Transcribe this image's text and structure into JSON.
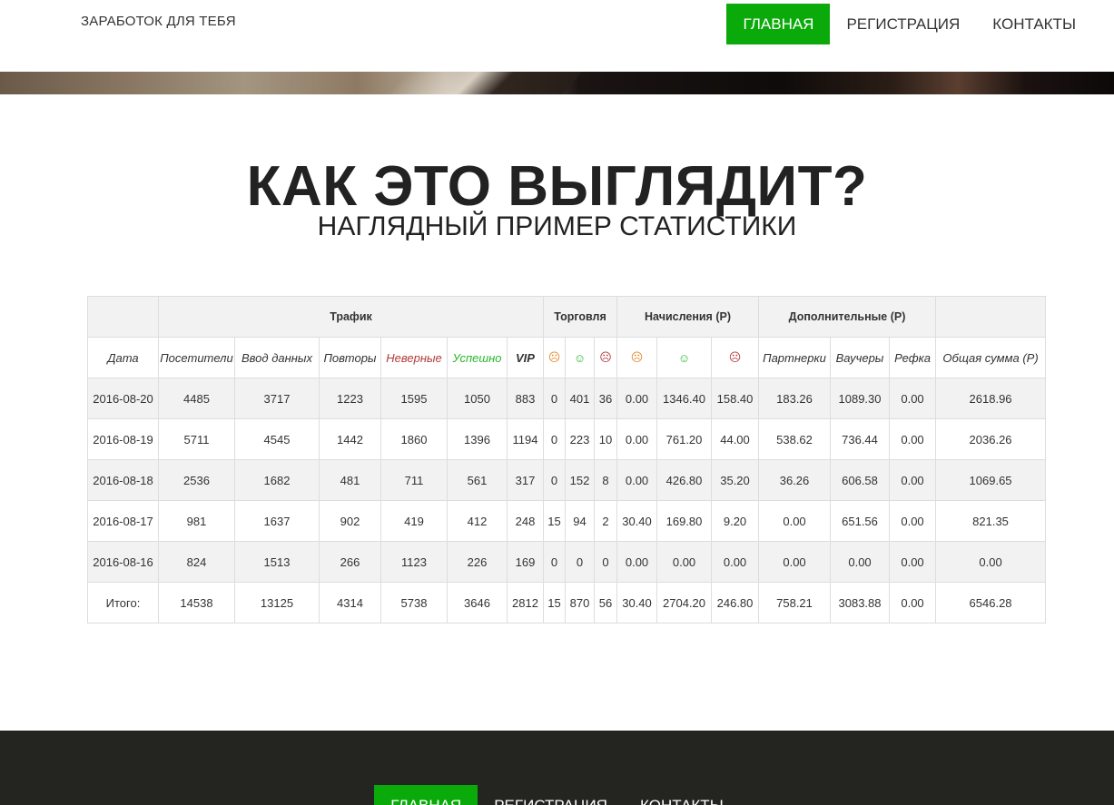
{
  "header": {
    "brand": "ЗАРАБОТОК ДЛЯ ТЕБЯ",
    "nav": [
      "ГЛАВНАЯ",
      "РЕГИСТРАЦИЯ",
      "КОНТАКТЫ"
    ]
  },
  "section": {
    "title": "КАК ЭТО ВЫГЛЯДИТ?",
    "subtitle": "НАГЛЯДНЫЙ ПРИМЕР СТАТИСТИКИ"
  },
  "table": {
    "groups": {
      "traffic": "Трафик",
      "trade": "Торговля",
      "accruals": "Начисления (Р)",
      "extra": "Дополнительные (Р)"
    },
    "columns": [
      "Дата",
      "Посетители",
      "Ввод данных",
      "Повторы",
      "Неверные",
      "Успешно",
      "VIP",
      "☹",
      "☺",
      "☹",
      "☹",
      "☺",
      "☹",
      "Партнерки",
      "Ваучеры",
      "Рефка",
      "Общая сумма (Р)"
    ],
    "rows": [
      [
        "2016-08-20",
        "4485",
        "3717",
        "1223",
        "1595",
        "1050",
        "883",
        "0",
        "401",
        "36",
        "0.00",
        "1346.40",
        "158.40",
        "183.26",
        "1089.30",
        "0.00",
        "2618.96"
      ],
      [
        "2016-08-19",
        "5711",
        "4545",
        "1442",
        "1860",
        "1396",
        "1194",
        "0",
        "223",
        "10",
        "0.00",
        "761.20",
        "44.00",
        "538.62",
        "736.44",
        "0.00",
        "2036.26"
      ],
      [
        "2016-08-18",
        "2536",
        "1682",
        "481",
        "711",
        "561",
        "317",
        "0",
        "152",
        "8",
        "0.00",
        "426.80",
        "35.20",
        "36.26",
        "606.58",
        "0.00",
        "1069.65"
      ],
      [
        "2016-08-17",
        "981",
        "1637",
        "902",
        "419",
        "412",
        "248",
        "15",
        "94",
        "2",
        "30.40",
        "169.80",
        "9.20",
        "0.00",
        "651.56",
        "0.00",
        "821.35"
      ],
      [
        "2016-08-16",
        "824",
        "1513",
        "266",
        "1123",
        "226",
        "169",
        "0",
        "0",
        "0",
        "0.00",
        "0.00",
        "0.00",
        "0.00",
        "0.00",
        "0.00",
        "0.00"
      ],
      [
        "Итого:",
        "14538",
        "13125",
        "4314",
        "5738",
        "3646",
        "2812",
        "15",
        "870",
        "56",
        "30.40",
        "2704.20",
        "246.80",
        "758.21",
        "3083.88",
        "0.00",
        "6546.28"
      ]
    ]
  },
  "footer": {
    "nav": [
      "ГЛАВНАЯ",
      "РЕГИСТРАЦИЯ",
      "КОНТАКТЫ"
    ]
  },
  "colors": {
    "accent": "#0baa0b",
    "footer_bg": "#242421",
    "invalid": "#b33a3a",
    "success": "#27b827"
  }
}
